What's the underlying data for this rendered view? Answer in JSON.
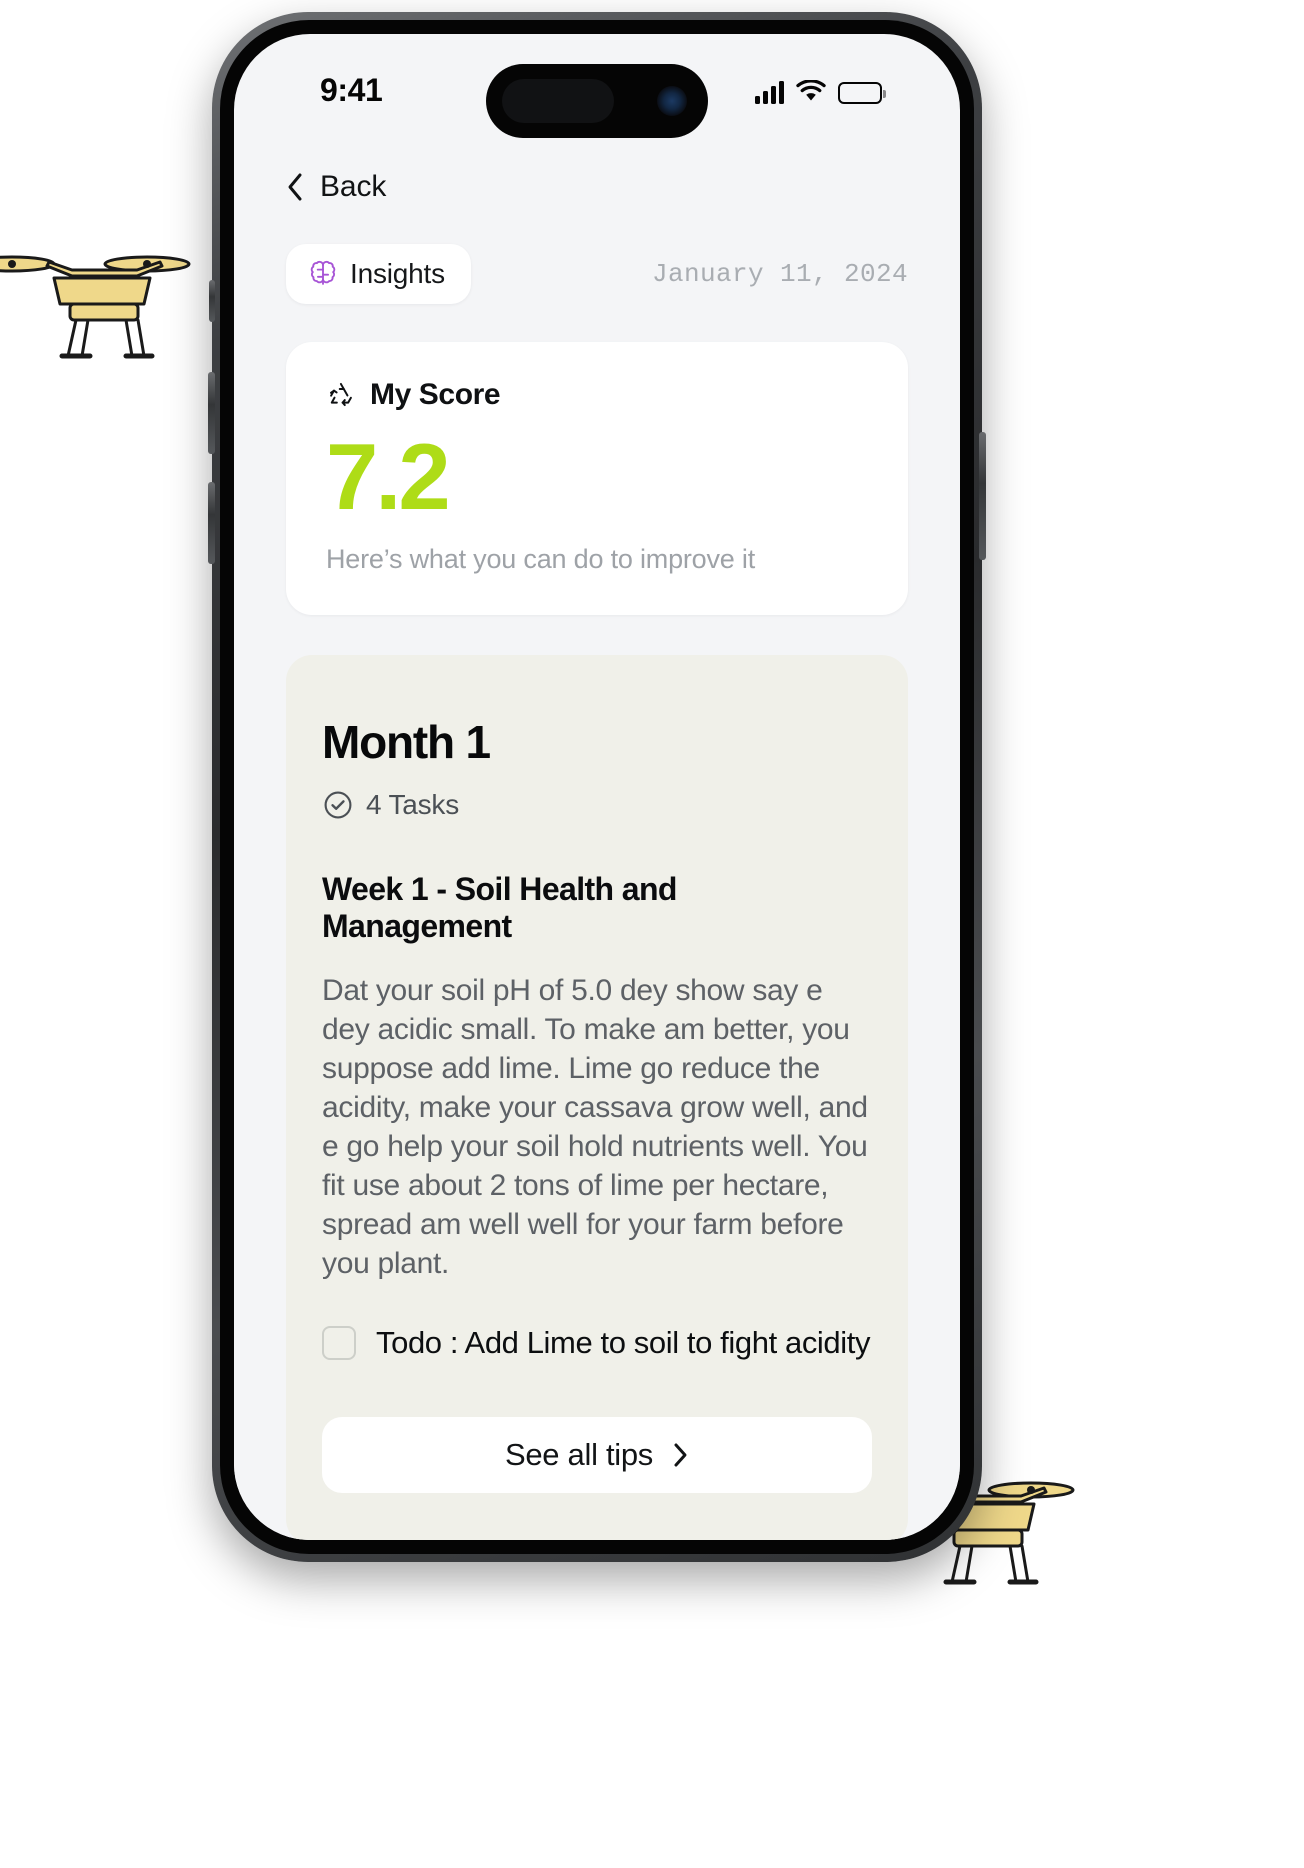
{
  "status_bar": {
    "time": "9:41",
    "icons": [
      "cellular-signal-icon",
      "wifi-icon",
      "battery-icon"
    ]
  },
  "nav": {
    "back_label": "Back",
    "back_icon": "chevron-left-icon"
  },
  "meta": {
    "insights_label": "Insights",
    "insights_icon": "brain-icon",
    "date": "January 11, 2024"
  },
  "score_card": {
    "icon": "recycle-icon",
    "title": "My Score",
    "value": "7.2",
    "value_color": "#aedc17",
    "subtitle": "Here’s what you can do to improve it"
  },
  "month_card": {
    "title": "Month 1",
    "tasks_icon": "check-circle-icon",
    "tasks_label": "4 Tasks",
    "week_title": "Week 1 - Soil Health and Management",
    "week_body": "Dat your soil pH of 5.0 dey show say e dey acidic small. To make am better, you suppose add lime. Lime go reduce the acidity, make your cassava grow well, and e go help your soil hold nutrients well. You fit use about 2 tons of lime per hectare, spread am well well for your farm before you plant.",
    "todo_label": "Todo : Add Lime to soil to fight acidity",
    "see_all_tips_label": "See all tips",
    "see_all_tips_icon": "chevron-right-icon",
    "background_color": "#f0f0e9"
  },
  "decorations": {
    "drone_left": "drone-icon",
    "drone_right": "drone-icon",
    "drone_body_color": "#efd88a",
    "drone_outline_color": "#1a1a1a"
  }
}
